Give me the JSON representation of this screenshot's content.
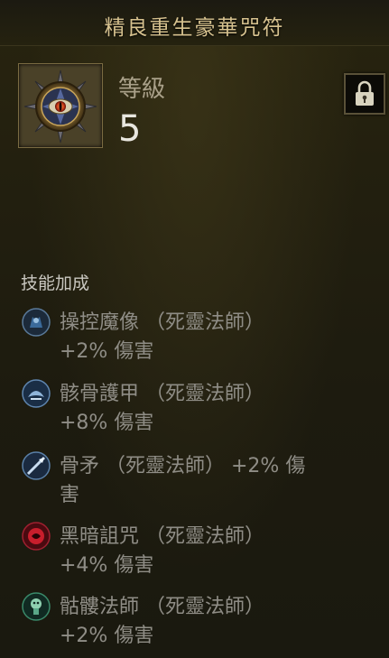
{
  "title": "精良重生豪華咒符",
  "level": {
    "label": "等級",
    "value": "5"
  },
  "section_title": "技能加成",
  "skills": [
    {
      "line1": "操控魔像 （死靈法師）",
      "line2": "+2% 傷害",
      "icon": "golem-icon"
    },
    {
      "line1": "骸骨護甲 （死靈法師）",
      "line2": "+8% 傷害",
      "icon": "bone-armor-icon"
    },
    {
      "line1": "骨矛 （死靈法師） +2% 傷",
      "line2": "害",
      "icon": "bone-spear-icon"
    },
    {
      "line1": "黑暗詛咒 （死靈法師）",
      "line2": "+4% 傷害",
      "icon": "dark-curse-icon"
    },
    {
      "line1": "骷髏法師 （死靈法師）",
      "line2": "+2% 傷害",
      "icon": "skeleton-mage-icon"
    }
  ],
  "colors": {
    "title": "#d7c28f",
    "text": "#8f8d86",
    "accent": "#e8e6df"
  }
}
